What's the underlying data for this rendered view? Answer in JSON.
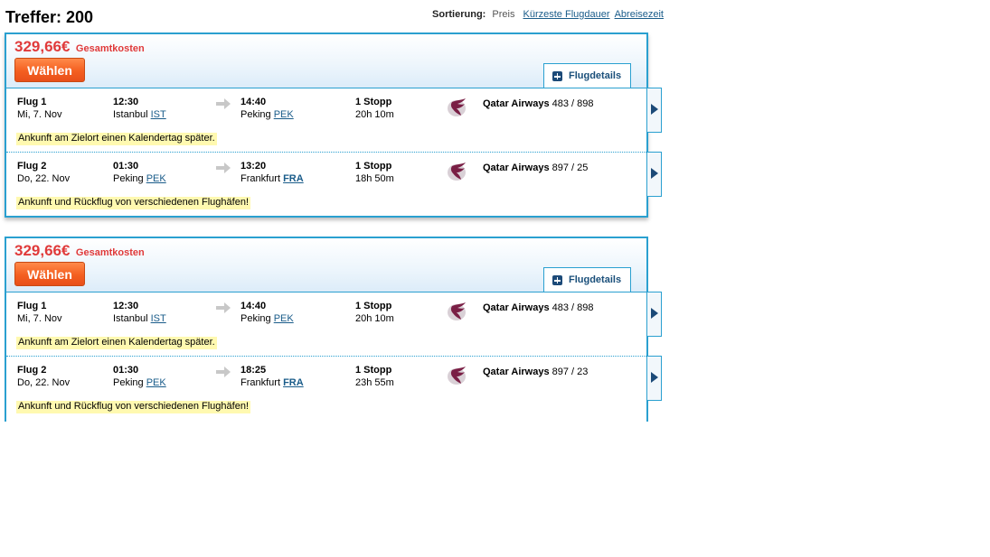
{
  "header": {
    "hits_label": "Treffer: 200",
    "sort_label": "Sortierung:",
    "sort_active": "Preis",
    "sort_options": [
      "Kürzeste Flugdauer",
      "Abreisezeit"
    ]
  },
  "colors": {
    "accent": "#2aa0d0",
    "price": "#e03a3a",
    "select_button": "#f45f20",
    "note_highlight": "#fff9b0",
    "link": "#1a5c8a"
  },
  "results": [
    {
      "price": "329,66€",
      "price_label": "Gesamtkosten",
      "select_label": "Wählen",
      "details_label": "Flugdetails",
      "flights": [
        {
          "name": "Flug 1",
          "date": "Mi, 7. Nov",
          "dep_time": "12:30",
          "dep_city": "Istanbul",
          "dep_code": "IST",
          "arr_time": "14:40",
          "arr_city": "Peking",
          "arr_code": "PEK",
          "stops": "1 Stopp",
          "duration": "20h 10m",
          "airline": "Qatar Airways",
          "flight_no": "483 / 898",
          "note": "Ankunft am Zielort einen Kalendertag später."
        },
        {
          "name": "Flug 2",
          "date": "Do, 22. Nov",
          "dep_time": "01:30",
          "dep_city": "Peking",
          "dep_code": "PEK",
          "arr_time": "13:20",
          "arr_city": "Frankfurt",
          "arr_code": "FRA",
          "stops": "1 Stopp",
          "duration": "18h 50m",
          "airline": "Qatar Airways",
          "flight_no": "897 / 25",
          "note": "Ankunft und Rückflug von verschiedenen Flughäfen!"
        }
      ]
    },
    {
      "price": "329,66€",
      "price_label": "Gesamtkosten",
      "select_label": "Wählen",
      "details_label": "Flugdetails",
      "flights": [
        {
          "name": "Flug 1",
          "date": "Mi, 7. Nov",
          "dep_time": "12:30",
          "dep_city": "Istanbul",
          "dep_code": "IST",
          "arr_time": "14:40",
          "arr_city": "Peking",
          "arr_code": "PEK",
          "stops": "1 Stopp",
          "duration": "20h 10m",
          "airline": "Qatar Airways",
          "flight_no": "483 / 898",
          "note": "Ankunft am Zielort einen Kalendertag später."
        },
        {
          "name": "Flug 2",
          "date": "Do, 22. Nov",
          "dep_time": "01:30",
          "dep_city": "Peking",
          "dep_code": "PEK",
          "arr_time": "18:25",
          "arr_city": "Frankfurt",
          "arr_code": "FRA",
          "stops": "1 Stopp",
          "duration": "23h 55m",
          "airline": "Qatar Airways",
          "flight_no": "897 / 23",
          "note": "Ankunft und Rückflug von verschiedenen Flughäfen!"
        }
      ]
    }
  ],
  "icons": {
    "plus": "plus-square-icon",
    "arrow": "arrow-right-icon",
    "airline": "qatar-airways-logo-icon",
    "next": "chevron-right-icon"
  }
}
